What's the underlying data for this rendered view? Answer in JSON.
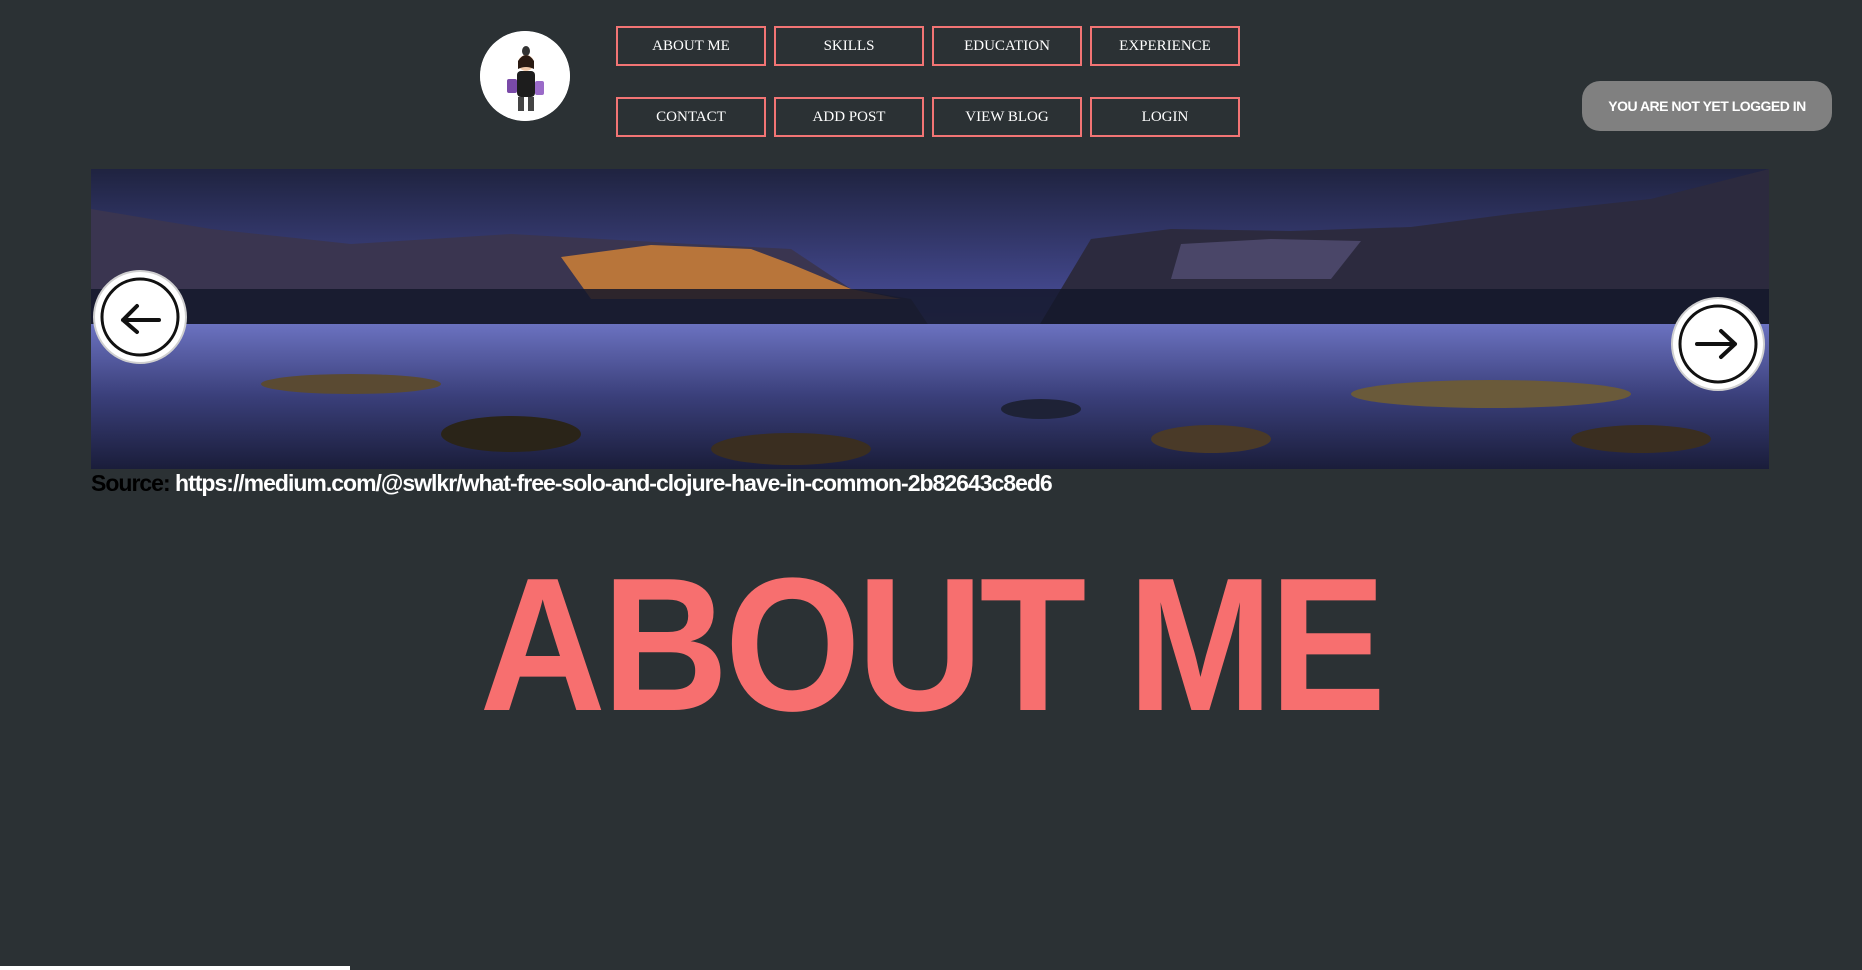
{
  "nav": {
    "row1": [
      "ABOUT ME",
      "SKILLS",
      "EDUCATION",
      "EXPERIENCE"
    ],
    "row2": [
      "CONTACT",
      "ADD POST",
      "VIEW BLOG",
      "LOGIN"
    ]
  },
  "auth": {
    "status": "YOU ARE NOT YET LOGGED IN"
  },
  "slider": {
    "prev_icon": "arrow-left-icon",
    "next_icon": "arrow-right-icon",
    "source_label": "Source:",
    "source_url": "https://medium.com/@swlkr/what-free-solo-and-clojure-have-in-common-2b82643c8ed6"
  },
  "page": {
    "title": "ABOUT ME"
  },
  "colors": {
    "background": "#2b3134",
    "accent": "#f76f6f",
    "nav_border": "#f27474",
    "badge": "#808080"
  }
}
